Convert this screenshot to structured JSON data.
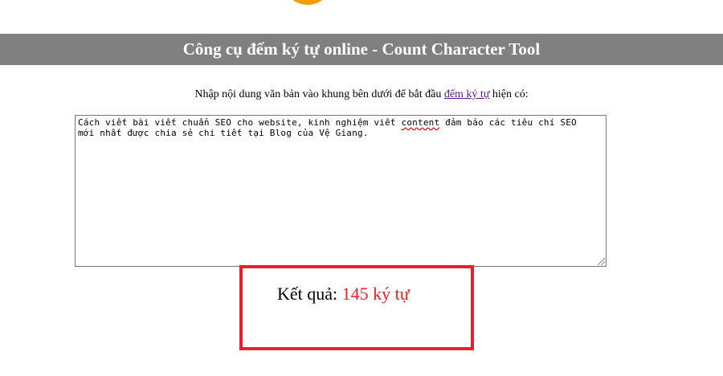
{
  "header": {
    "title": "Công cụ đếm ký tự online - Count Character Tool"
  },
  "instruction": {
    "before_link": "Nhập nội dung văn bản vào khung bên dưới để bắt đầu ",
    "link_text": "đếm ký tự",
    "after_link": " hiện có:"
  },
  "input": {
    "line1_before": "Cách viết bài viết chuẩn SEO cho website, kinh nghiệm viết ",
    "line1_misspelled": "content",
    "line1_after": " đảm bảo các tiêu chí SEO",
    "line2": "mới nhất được chia sẻ chi tiết tại Blog của Vệ Giang."
  },
  "result": {
    "label": "Kết quả: ",
    "value": "145 ký tự"
  },
  "colors": {
    "header_bg": "#808080",
    "result_accent": "#e8202a",
    "link": "#551a8b"
  }
}
